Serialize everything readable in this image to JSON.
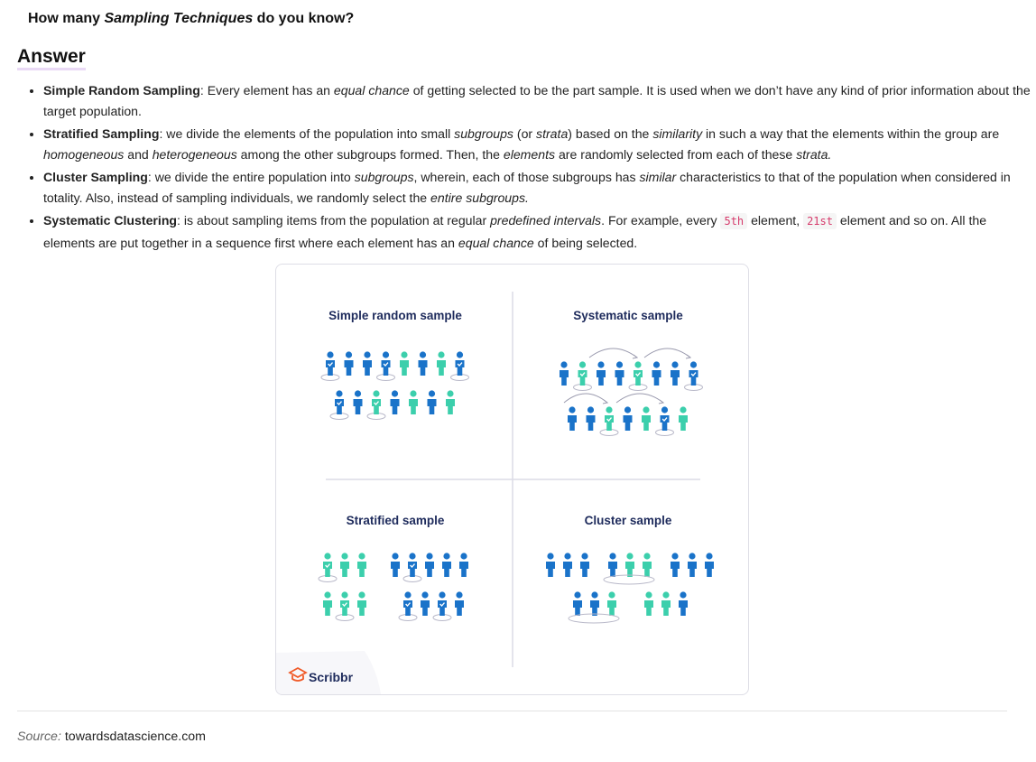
{
  "question": {
    "prefix": "How many ",
    "emphasis": "Sampling Techniques",
    "suffix": " do you know?"
  },
  "answer_heading": "Answer",
  "definitions": [
    {
      "term": "Simple Random Sampling",
      "parts": [
        {
          "t": ": Every element has an "
        },
        {
          "t": "equal chance",
          "i": true
        },
        {
          "t": " of getting selected to be the part sample. It is used when we don’t have any kind of prior information about the target population."
        }
      ]
    },
    {
      "term": "Stratified Sampling",
      "parts": [
        {
          "t": ": we divide the elements of the population into small "
        },
        {
          "t": "subgroups",
          "i": true
        },
        {
          "t": " (or "
        },
        {
          "t": "strata",
          "i": true
        },
        {
          "t": ") based on the "
        },
        {
          "t": "similarity",
          "i": true
        },
        {
          "t": " in such a way that the elements within the group are "
        },
        {
          "t": "homogeneous",
          "i": true
        },
        {
          "t": " and "
        },
        {
          "t": "heterogeneous",
          "i": true
        },
        {
          "t": " among the other subgroups formed. Then, the "
        },
        {
          "t": "elements",
          "i": true
        },
        {
          "t": " are randomly selected from each of these "
        },
        {
          "t": "strata.",
          "i": true
        }
      ]
    },
    {
      "term": "Cluster Sampling",
      "parts": [
        {
          "t": ": we divide the entire population into "
        },
        {
          "t": "subgroups",
          "i": true
        },
        {
          "t": ", wherein, each of those subgroups has "
        },
        {
          "t": "similar",
          "i": true
        },
        {
          "t": " characteristics to that of the population when considered in totality. Also, instead of sampling individuals, we randomly select the "
        },
        {
          "t": "entire subgroups.",
          "i": true
        }
      ]
    },
    {
      "term": "Systematic Clustering",
      "parts": [
        {
          "t": ": is about sampling items from the population at regular "
        },
        {
          "t": "predefined intervals",
          "i": true
        },
        {
          "t": ". For example, every "
        },
        {
          "t": "5th",
          "code": true
        },
        {
          "t": " element, "
        },
        {
          "t": "21st",
          "code": true
        },
        {
          "t": " element and so on. All the elements are put together in a sequence first where each element has an "
        },
        {
          "t": "equal chance",
          "i": true
        },
        {
          "t": " of being selected."
        }
      ]
    }
  ],
  "figure": {
    "panels": [
      {
        "title": "Simple random sample"
      },
      {
        "title": "Systematic sample"
      },
      {
        "title": "Stratified sample"
      },
      {
        "title": "Cluster sample"
      }
    ],
    "brand": "Scribbr",
    "colors": {
      "blue": "#1a73c9",
      "teal": "#3ccfac",
      "title": "#1e2b5c",
      "ring": "#b9b9c9",
      "brand": "#f05a28"
    }
  },
  "source": {
    "label": "Source:",
    "site": "towardsdatascience.com"
  }
}
